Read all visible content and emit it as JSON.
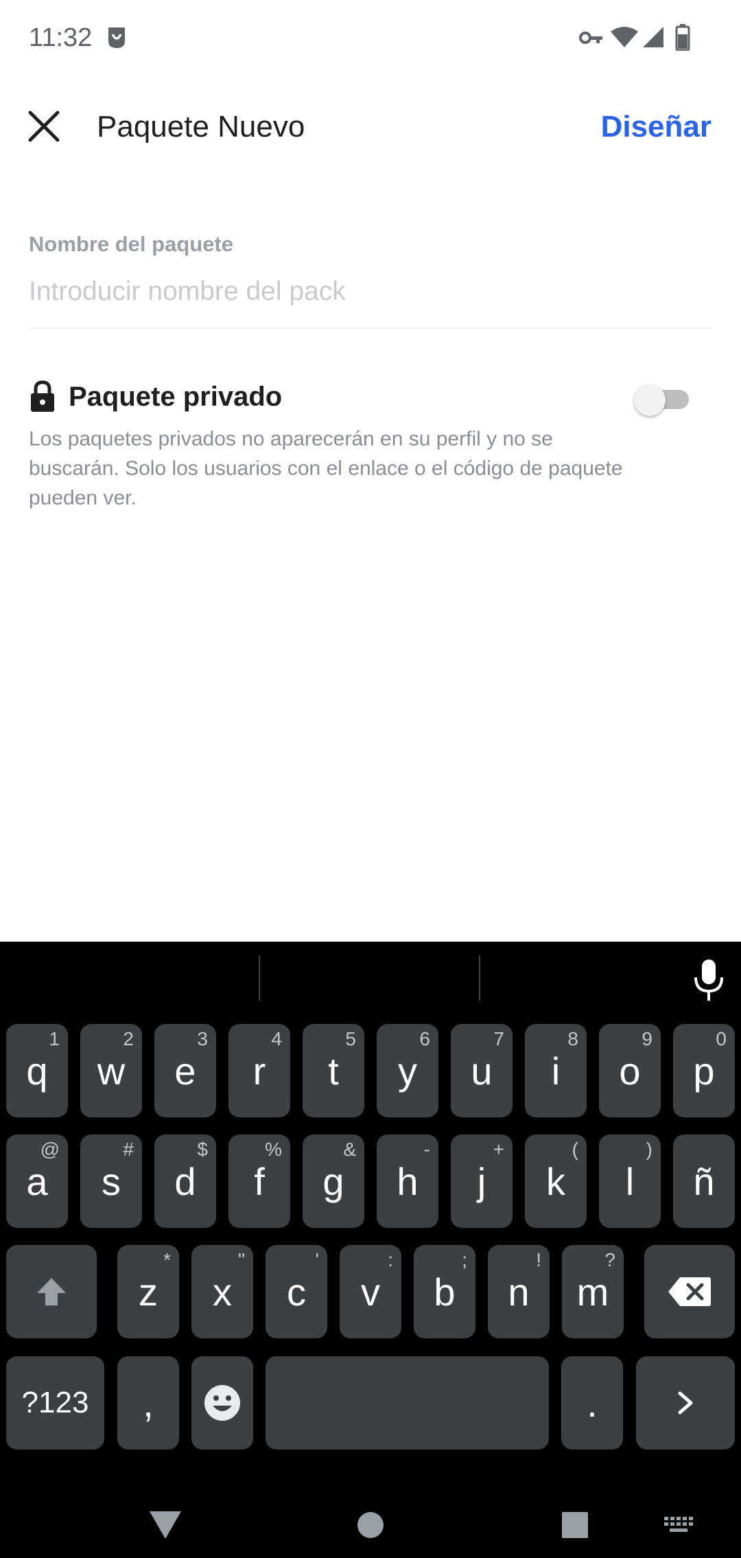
{
  "status_bar": {
    "time": "11:32",
    "icons": [
      "badge-icon",
      "vpn-key-icon",
      "wifi-icon",
      "signal-icon",
      "battery-icon"
    ]
  },
  "app_bar": {
    "title": "Paquete Nuevo",
    "action_label": "Diseñar",
    "accent_color": "#2a62e8"
  },
  "form": {
    "name_label": "Nombre del paquete",
    "name_value": "",
    "name_placeholder": "Introducir nombre del pack",
    "private_title": "Paquete privado",
    "private_description": "Los paquetes privados no aparecerán en su perfil y no se buscarán. Solo los usuarios con el enlace o el código de paquete pueden ver.",
    "private_enabled": false
  },
  "keyboard": {
    "row1": [
      {
        "key": "q",
        "hint": "1"
      },
      {
        "key": "w",
        "hint": "2"
      },
      {
        "key": "e",
        "hint": "3"
      },
      {
        "key": "r",
        "hint": "4"
      },
      {
        "key": "t",
        "hint": "5"
      },
      {
        "key": "y",
        "hint": "6"
      },
      {
        "key": "u",
        "hint": "7"
      },
      {
        "key": "i",
        "hint": "8"
      },
      {
        "key": "o",
        "hint": "9"
      },
      {
        "key": "p",
        "hint": "0"
      }
    ],
    "row2": [
      {
        "key": "a",
        "hint": "@"
      },
      {
        "key": "s",
        "hint": "#"
      },
      {
        "key": "d",
        "hint": "$"
      },
      {
        "key": "f",
        "hint": "%"
      },
      {
        "key": "g",
        "hint": "&"
      },
      {
        "key": "h",
        "hint": "-"
      },
      {
        "key": "j",
        "hint": "+"
      },
      {
        "key": "k",
        "hint": "("
      },
      {
        "key": "l",
        "hint": ")"
      },
      {
        "key": "ñ",
        "hint": ""
      }
    ],
    "row3": [
      {
        "key": "z",
        "hint": "*"
      },
      {
        "key": "x",
        "hint": "\""
      },
      {
        "key": "c",
        "hint": "'"
      },
      {
        "key": "v",
        "hint": ":"
      },
      {
        "key": "b",
        "hint": ";"
      },
      {
        "key": "n",
        "hint": "!"
      },
      {
        "key": "m",
        "hint": "?"
      }
    ],
    "symbols_label": "?123",
    "comma_label": ",",
    "period_label": ".",
    "enter_label": "›"
  },
  "nav_bar": {
    "icons": [
      "back-icon",
      "home-icon",
      "recents-icon",
      "keyboard-switch-icon"
    ]
  }
}
